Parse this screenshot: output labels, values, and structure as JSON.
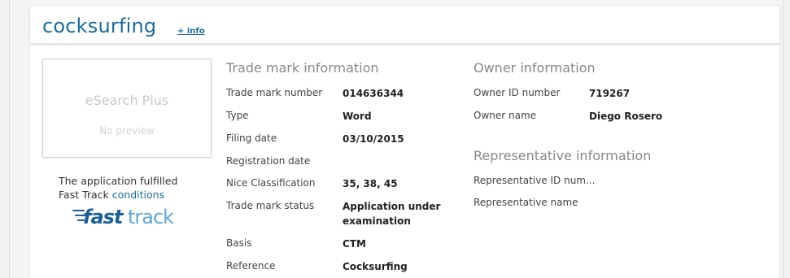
{
  "header": {
    "title": "cocksurfing",
    "info_link": "+ info"
  },
  "preview": {
    "title": "eSearch Plus",
    "subtitle": "No preview"
  },
  "fast_track": {
    "line1": "The application fulfilled",
    "line2_prefix": "Fast Track ",
    "line2_link": "conditions",
    "logo_word1": "fast",
    "logo_word2": "track",
    "logo_color_fast": "#1a5f96",
    "logo_color_track": "#5fa8d8"
  },
  "trademark": {
    "title": "Trade mark information",
    "rows": [
      {
        "label": "Trade mark number",
        "value": "014636344"
      },
      {
        "label": "Type",
        "value": "Word"
      },
      {
        "label": "Filing date",
        "value": "03/10/2015"
      },
      {
        "label": "Registration date",
        "value": ""
      },
      {
        "label": "Nice Classification",
        "value": "35, 38, 45"
      },
      {
        "label": "Trade mark status",
        "value_line1": "Application under",
        "value_line2": "examination"
      },
      {
        "label": "Basis",
        "value": "CTM"
      },
      {
        "label": "Reference",
        "value": "Cocksurfing"
      }
    ]
  },
  "owner": {
    "title": "Owner information",
    "rows": [
      {
        "label": "Owner ID number",
        "value": "719267"
      },
      {
        "label": "Owner name",
        "value": "Diego Rosero"
      }
    ]
  },
  "representative": {
    "title": "Representative information",
    "rows": [
      {
        "label": "Representative ID num...",
        "value": ""
      },
      {
        "label": "Representative name",
        "value": ""
      }
    ]
  }
}
